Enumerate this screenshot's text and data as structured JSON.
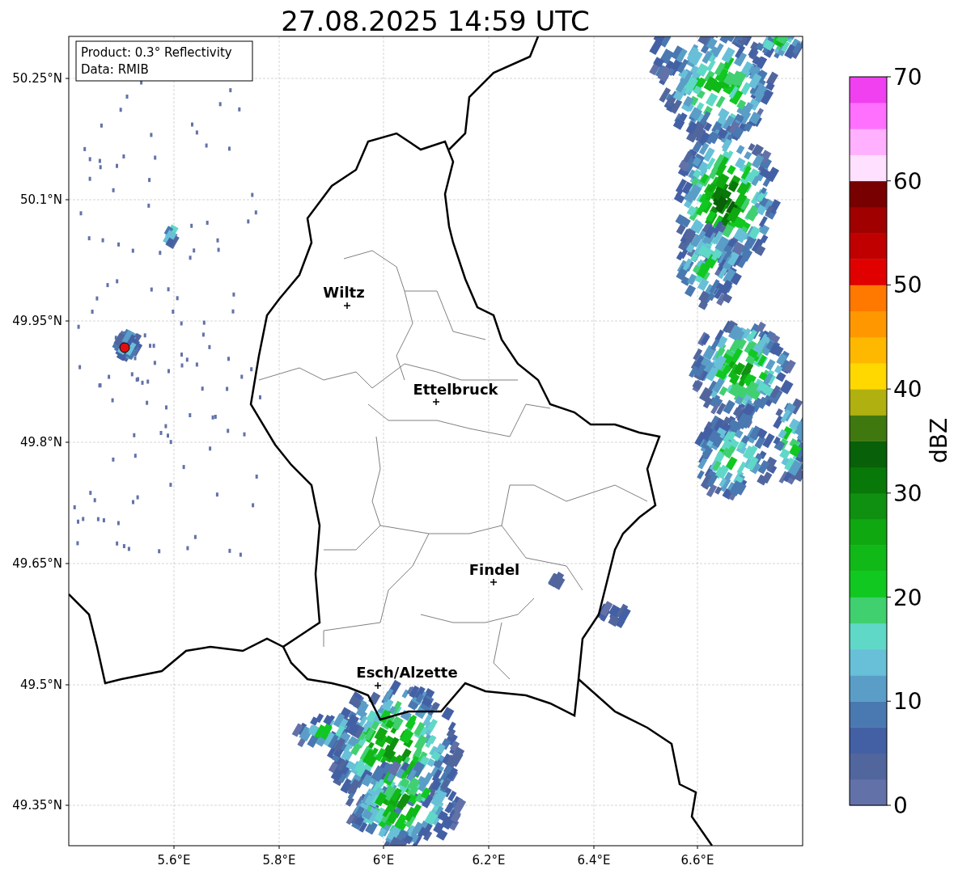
{
  "title": "27.08.2025 14:59 UTC",
  "info_box": [
    "Product: 0.3° Reflectivity",
    "Data: RMIB"
  ],
  "x_ticks": [
    "5.6°E",
    "5.8°E",
    "6°E",
    "6.2°E",
    "6.4°E",
    "6.6°E"
  ],
  "y_ticks": [
    "50.25°N",
    "50.1°N",
    "49.95°N",
    "49.8°N",
    "49.65°N",
    "49.5°N",
    "49.35°N"
  ],
  "cities": [
    {
      "name": "Wiltz"
    },
    {
      "name": "Ettelbruck"
    },
    {
      "name": "Findel"
    },
    {
      "name": "Esch/Alzette"
    }
  ],
  "colorbar": {
    "label": "dBZ",
    "ticks": [
      "70",
      "60",
      "50",
      "40",
      "30",
      "20",
      "10",
      "0"
    ],
    "bins": [
      {
        "color": "#6272a8"
      },
      {
        "color": "#52669e"
      },
      {
        "color": "#4460a5"
      },
      {
        "color": "#4a78b0"
      },
      {
        "color": "#5a9ec8"
      },
      {
        "color": "#68c0d8"
      },
      {
        "color": "#60d8c8"
      },
      {
        "color": "#40d070"
      },
      {
        "color": "#10c820"
      },
      {
        "color": "#10b818"
      },
      {
        "color": "#10a810"
      },
      {
        "color": "#109010"
      },
      {
        "color": "#087808"
      },
      {
        "color": "#086008"
      },
      {
        "color": "#407810"
      },
      {
        "color": "#b0b010"
      },
      {
        "color": "#ffd800"
      },
      {
        "color": "#ffb800"
      },
      {
        "color": "#ff9800"
      },
      {
        "color": "#ff7800"
      },
      {
        "color": "#e00000"
      },
      {
        "color": "#c00000"
      },
      {
        "color": "#a00000"
      },
      {
        "color": "#780000"
      },
      {
        "color": "#ffe0ff"
      },
      {
        "color": "#ffb0ff"
      },
      {
        "color": "#ff70ff"
      },
      {
        "color": "#f040f0"
      }
    ]
  }
}
